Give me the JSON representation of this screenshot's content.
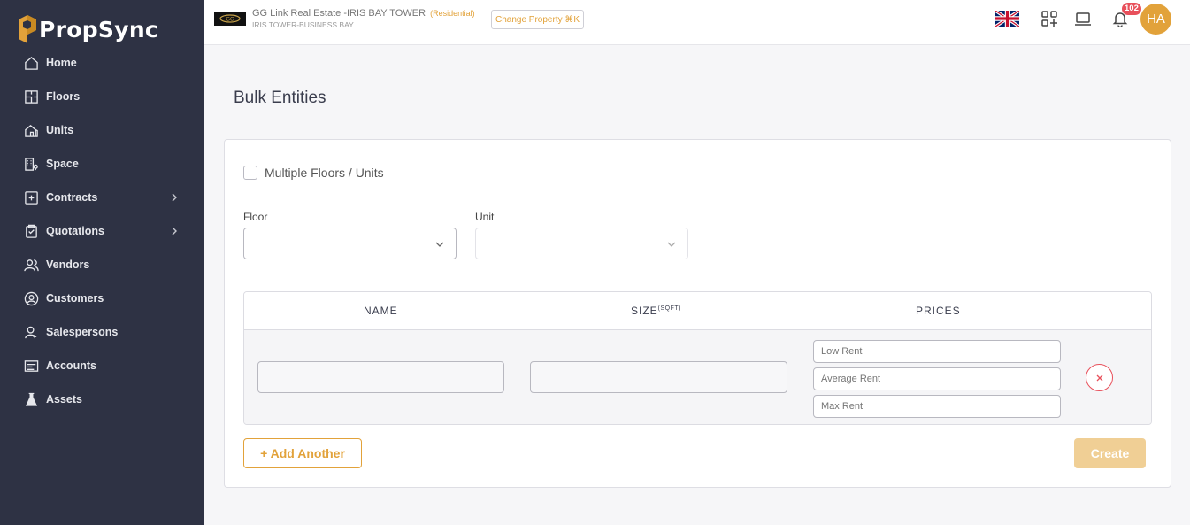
{
  "app": {
    "name": "PropSync"
  },
  "sidebar": {
    "items": [
      {
        "label": "Home",
        "icon": "home-icon"
      },
      {
        "label": "Floors",
        "icon": "floors-icon"
      },
      {
        "label": "Units",
        "icon": "units-icon"
      },
      {
        "label": "Space",
        "icon": "space-icon"
      },
      {
        "label": "Contracts",
        "icon": "contracts-icon",
        "has_submenu": true
      },
      {
        "label": "Quotations",
        "icon": "quotations-icon",
        "has_submenu": true
      },
      {
        "label": "Vendors",
        "icon": "vendors-icon"
      },
      {
        "label": "Customers",
        "icon": "customers-icon"
      },
      {
        "label": "Salespersons",
        "icon": "salespersons-icon"
      },
      {
        "label": "Accounts",
        "icon": "accounts-icon"
      },
      {
        "label": "Assets",
        "icon": "assets-icon"
      }
    ]
  },
  "topbar": {
    "property_title": "GG Link Real Estate -IRIS BAY TOWER",
    "property_type": "(Residential)",
    "property_subtitle": "IRIS TOWER-BUSINESS BAY",
    "change_property_label": "Change Property ⌘K",
    "notification_count": "102",
    "avatar_initials": "HA"
  },
  "page": {
    "title": "Bulk Entities",
    "multiple_label": "Multiple Floors / Units",
    "floor_label": "Floor",
    "unit_label": "Unit",
    "floor_value": "",
    "unit_value": ""
  },
  "table": {
    "headers": {
      "name": "NAME",
      "size": "SIZE",
      "size_unit": "(SQFT)",
      "prices": "PRICES"
    },
    "rows": [
      {
        "name": "",
        "size": "",
        "low_rent_placeholder": "Low Rent",
        "average_rent_placeholder": "Average Rent",
        "max_rent_placeholder": "Max Rent"
      }
    ]
  },
  "actions": {
    "add_another": "+ Add Another",
    "create": "Create"
  },
  "colors": {
    "sidebar_bg": "#2e3244",
    "accent": "#e2a23a",
    "danger": "#e8505b",
    "create_disabled": "#f0cf95"
  }
}
